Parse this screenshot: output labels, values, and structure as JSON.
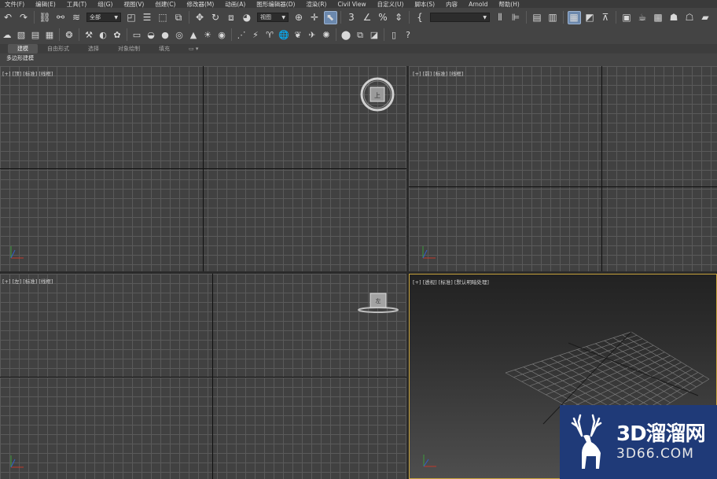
{
  "menu": [
    "文件(F)",
    "编辑(E)",
    "工具(T)",
    "组(G)",
    "视图(V)",
    "创建(C)",
    "修改器(M)",
    "动画(A)",
    "图形编辑器(D)",
    "渲染(R)",
    "Civil View",
    "自定义(U)",
    "脚本(S)",
    "内容",
    "Arnold",
    "帮助(H)"
  ],
  "toolbar": {
    "selection_filter": "全部",
    "ref_coord": "视图",
    "named_selection": ""
  },
  "ribbon": {
    "tabs": [
      "建模",
      "自由形式",
      "选择",
      "对象绘制",
      "填充"
    ],
    "active_tab": 0,
    "sub_label": "多边形建模"
  },
  "viewports": {
    "top": "[+] [顶] [标准] [线框]",
    "front": "[+] [前] [标准] [线框]",
    "left": "[+] [左] [标准] [线框]",
    "perspective": "[+] [透视] [标准] [默认明暗处理]"
  },
  "viewcube": {
    "top_face": "上",
    "left_face": "左"
  },
  "colors": {
    "ui_bg": "#444444",
    "viewport_bg": "#414141",
    "active_border": "#c7a33d",
    "watermark_bg": "#1f3a78"
  },
  "watermark": {
    "title": "3D溜溜网",
    "subtitle": "3D66.COM"
  }
}
